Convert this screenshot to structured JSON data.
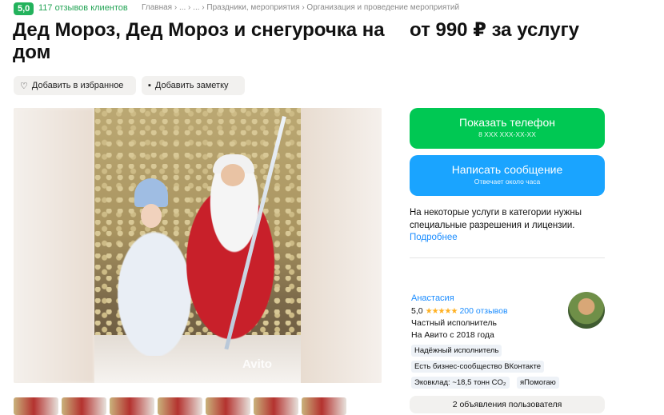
{
  "header": {
    "rating": "5,0",
    "reviews_link": "117 отзывов клиентов",
    "breadcrumbs": "Главная › ... › ... › Праздники, мероприятия › Организация и проведение мероприятий"
  },
  "listing": {
    "title": "Дед Мороз, Дед Мороз и снегурочка на дом",
    "price": "от 990 ₽ за услугу"
  },
  "actions": {
    "favorite_label": "Добавить в избранное",
    "note_label": "Добавить заметку"
  },
  "photo": {
    "watermark": "Avito",
    "thumb_count_visible": 7
  },
  "contact": {
    "phone_label": "Показать телефон",
    "phone_mask": "8 XXX XXX-XX-XX",
    "message_label": "Написать сообщение",
    "message_sub": "Отвечает около часа",
    "phone_color": "#00c853",
    "message_color": "#1aa4ff"
  },
  "notice": {
    "text": "На некоторые услуги в категории нужны специальные разрешения и лицензии.",
    "more_link": "Подробнее"
  },
  "seller": {
    "name": "Анастасия",
    "rating": "5,0",
    "stars": "★★★★★",
    "reviews": "200 отзывов",
    "type": "Частный исполнитель",
    "since": "На Авито с 2018 года",
    "tags": [
      "Надёжный исполнитель",
      "Есть бизнес-сообщество ВКонтакте",
      "Эковклад: ~18,5 тонн CO₂",
      "яПомогаю"
    ],
    "ads_button": "2 объявления пользователя"
  }
}
